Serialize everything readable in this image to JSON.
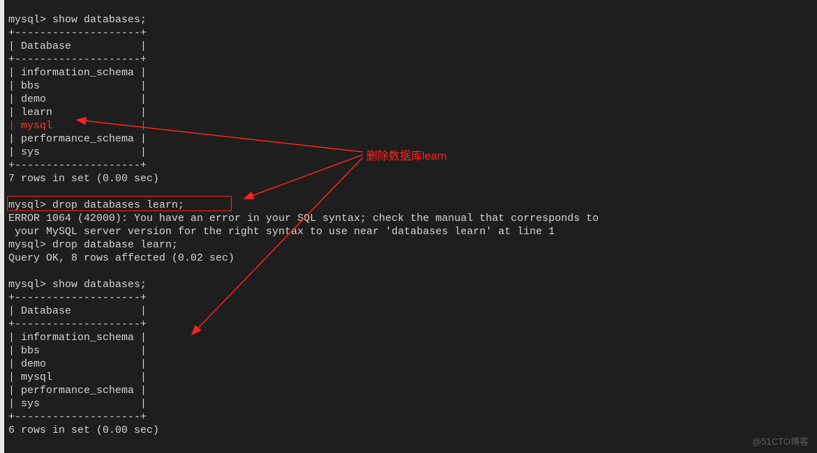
{
  "terminal": {
    "cmd1_prompt": "mysql> ",
    "cmd1": "show databases;",
    "sep1": "+--------------------+",
    "hdr1": "| Database           |",
    "sep2": "+--------------------+",
    "rows1": [
      "| information_schema |",
      "| bbs                |",
      "| demo               |",
      "| learn              |",
      "| mysql              |",
      "| performance_schema |",
      "| sys                |"
    ],
    "sep3": "+--------------------+",
    "result1": "7 rows in set (0.00 sec)",
    "blank1": "",
    "cmd2_prompt": "mysql> ",
    "cmd2": "drop databases learn;",
    "err_line1": "ERROR 1064 (42000): You have an error in your SQL syntax; check the manual that corresponds to",
    "err_line2": " your MySQL server version for the right syntax to use near 'databases learn' at line 1",
    "cmd3_prompt": "mysql> ",
    "cmd3": "drop database learn;",
    "result2": "Query OK, 8 rows affected (0.02 sec)",
    "blank2": "",
    "cmd4_prompt": "mysql> ",
    "cmd4": "show databases;",
    "sep4": "+--------------------+",
    "hdr2": "| Database           |",
    "sep5": "+--------------------+",
    "rows2": [
      "| information_schema |",
      "| bbs                |",
      "| demo               |",
      "| mysql              |",
      "| performance_schema |",
      "| sys                |"
    ],
    "sep6": "+--------------------+",
    "result3": "6 rows in set (0.00 sec)"
  },
  "annotation": {
    "label": "删除数据库learn"
  },
  "watermark": "@51CTO博客"
}
